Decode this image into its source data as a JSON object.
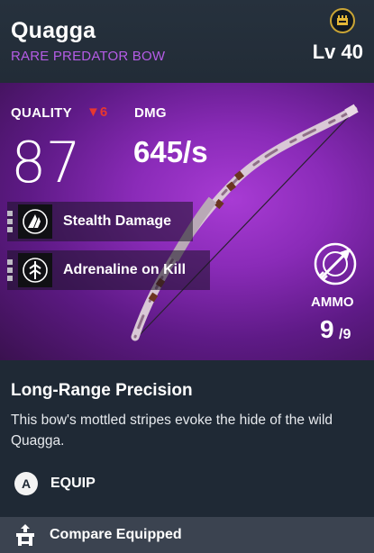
{
  "header": {
    "item_name": "Quagga",
    "rarity": "RARE PREDATOR BOW",
    "level": "Lv 40",
    "crown_icon": "crown-icon"
  },
  "stats": {
    "quality_label": "QUALITY",
    "quality_drop": "6",
    "quality_value": "87",
    "dmg_label": "DMG",
    "dmg_value": "645/s"
  },
  "perks": [
    {
      "label": "Stealth Damage",
      "icon": "stealth-icon"
    },
    {
      "label": "Adrenaline on Kill",
      "icon": "adrenaline-icon"
    }
  ],
  "ammo": {
    "label": "AMMO",
    "current": "9",
    "max": "/9",
    "icon": "arrow-target-icon"
  },
  "description": {
    "title": "Long-Range Precision",
    "body": "This bow's mottled stripes evoke the hide of the wild Quagga."
  },
  "actions": {
    "equip_button_glyph": "A",
    "equip_label": "EQUIP",
    "compare_label": "Compare Equipped"
  },
  "colors": {
    "rarity": "#b55ce6",
    "quality_drop": "#e8372f",
    "art_background": "#8a2bb8",
    "footer": "#3b4350"
  }
}
